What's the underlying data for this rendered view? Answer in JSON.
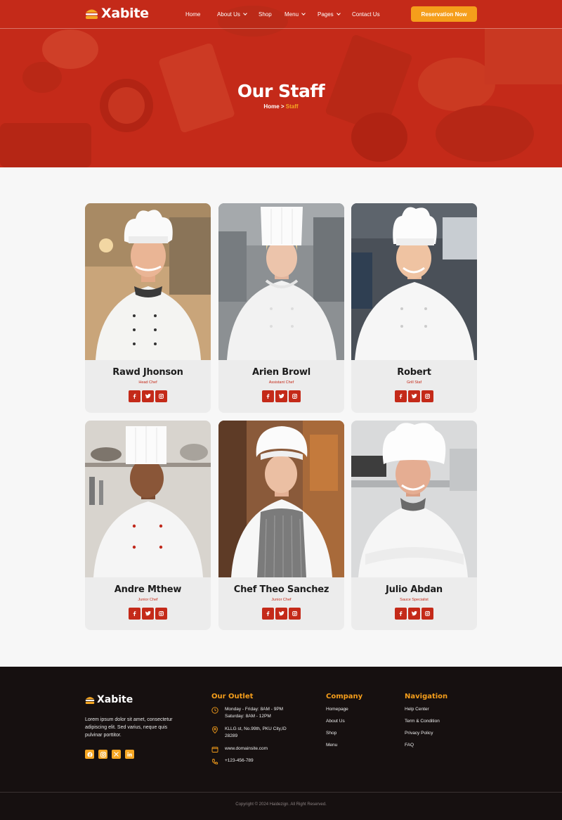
{
  "brand": {
    "name": "Xabite"
  },
  "nav": {
    "items": [
      {
        "label": "Home"
      },
      {
        "label": "About Us"
      },
      {
        "label": "Shop"
      },
      {
        "label": "Menu"
      },
      {
        "label": "Pages"
      },
      {
        "label": "Contact Us"
      }
    ],
    "cta": "Reservation Now"
  },
  "hero": {
    "title": "Our Staff",
    "breadcrumb_home": "Home",
    "breadcrumb_sep": " > ",
    "breadcrumb_current": "Staff"
  },
  "staff": [
    {
      "name": "Rawd Jhonson",
      "role": "Head Chef"
    },
    {
      "name": "Arien Browl",
      "role": "Assistant Chef"
    },
    {
      "name": "Robert",
      "role": "Grill Staf"
    },
    {
      "name": "Andre Mthew",
      "role": "Junior Chef"
    },
    {
      "name": "Chef Theo Sanchez",
      "role": "Junior Chef"
    },
    {
      "name": "Julio Abdan",
      "role": "Sauce Specialist"
    }
  ],
  "footer": {
    "brand": "Xabite",
    "description": "Lorem ipsum dolor sit amet, consectetur adipiscing elit. Sed varius, neque quis pulvinar porttitor.",
    "outlet": {
      "heading": "Our Outlet",
      "hours_1": "Monday - Friday: 8AM - 9PM",
      "hours_2": "Saturday: 8AM - 12PM",
      "address": "KLLG st, No.99th, PKU City,ID 28289",
      "website": "www.domainsite.com",
      "phone": "+123-456-789"
    },
    "company": {
      "heading": "Company",
      "links": [
        "Homepage",
        "About Us",
        "Shop",
        "Menu"
      ]
    },
    "navigation": {
      "heading": "Navigation",
      "links": [
        "Help Center",
        "Term & Condition",
        "Privacy Policy",
        "FAQ"
      ]
    },
    "copyright": "Copyright © 2024 Haidezign. All Right Reserved."
  },
  "colors": {
    "brand_red": "#c42a19",
    "accent_orange": "#f59e1b",
    "footer_bg": "#161010"
  }
}
